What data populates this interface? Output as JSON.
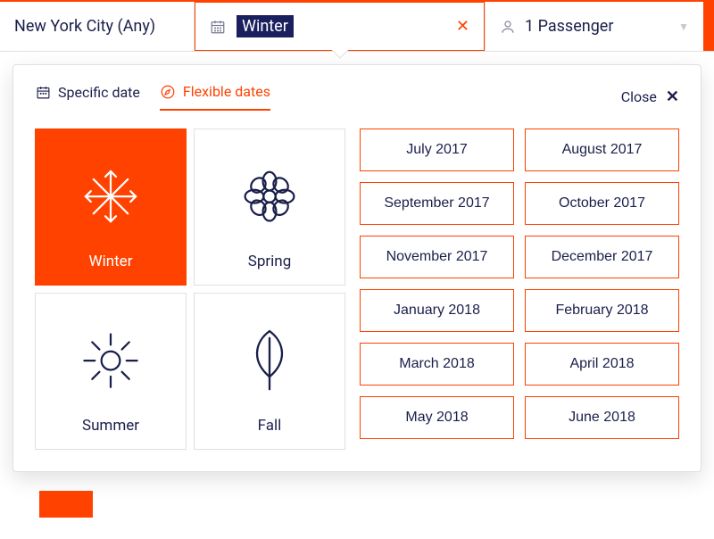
{
  "top": {
    "location": "New York City (Any)",
    "date_value": "Winter",
    "passengers": "1 Passenger"
  },
  "dropdown": {
    "tab_specific": "Specific date",
    "tab_flexible": "Flexible dates",
    "close_label": "Close",
    "seasons": {
      "winter": "Winter",
      "spring": "Spring",
      "summer": "Summer",
      "fall": "Fall"
    },
    "months": [
      "July 2017",
      "August 2017",
      "September 2017",
      "October 2017",
      "November 2017",
      "December 2017",
      "January 2018",
      "February 2018",
      "March 2018",
      "April 2018",
      "May 2018",
      "June 2018"
    ]
  }
}
